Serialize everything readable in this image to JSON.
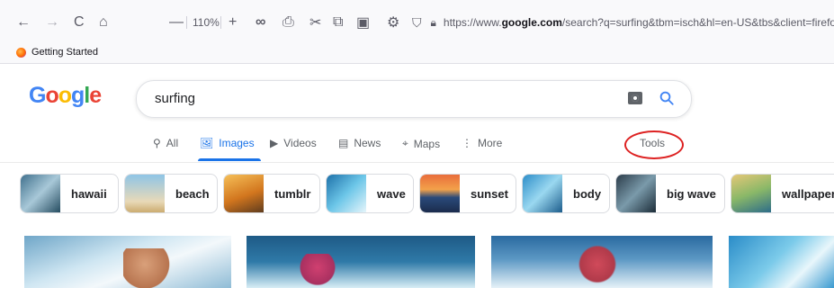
{
  "browser": {
    "zoom": "110%",
    "url_prefix": "https://www.",
    "url_domain": "google.com",
    "url_rest": "/search?q=surfing&tbm=isch&hl=en-US&tbs&client=firefox",
    "bookmark": "Getting Started"
  },
  "search": {
    "query": "surfing"
  },
  "tabs": [
    {
      "label": "All",
      "icon": "search-icon"
    },
    {
      "label": "Images",
      "icon": "image-icon"
    },
    {
      "label": "Videos",
      "icon": "video-icon"
    },
    {
      "label": "News",
      "icon": "news-icon"
    },
    {
      "label": "Maps",
      "icon": "map-pin-icon"
    },
    {
      "label": "More",
      "icon": "more-vert-icon"
    }
  ],
  "tools_label": "Tools",
  "chips": [
    {
      "label": "hawaii"
    },
    {
      "label": "beach"
    },
    {
      "label": "tumblr"
    },
    {
      "label": "wave"
    },
    {
      "label": "sunset"
    },
    {
      "label": "body"
    },
    {
      "label": "big wave"
    },
    {
      "label": "wallpaper"
    }
  ],
  "colors": {
    "accent": "#1a73e8",
    "annotation": "#dd2222"
  }
}
